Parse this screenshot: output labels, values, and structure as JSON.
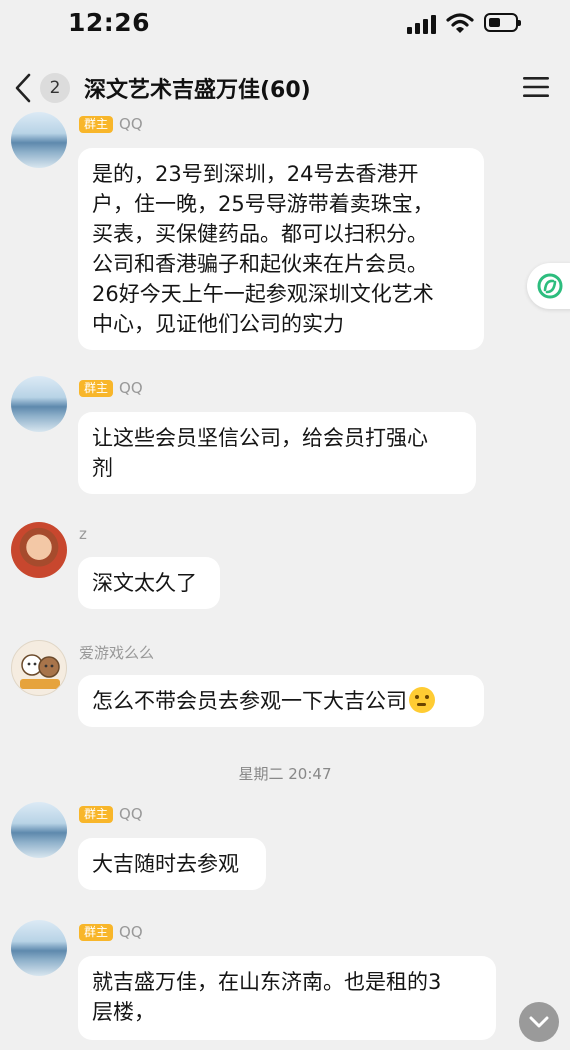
{
  "status_bar": {
    "time": "12:26"
  },
  "header": {
    "unread_count": "2",
    "title": "深文艺术吉盛万佳(60)"
  },
  "messages": [
    {
      "role": "群主",
      "sender": "QQ",
      "lines": [
        "是的，23号到深圳，24号去香港开",
        "户，住一晚，25号导游带着卖珠宝，",
        "买表，买保健药品。都可以扫积分。",
        "公司和香港骗子和起伙来在片会员。",
        "26好今天上午一起参观深圳文化艺术",
        "中心，见证他们公司的实力"
      ]
    },
    {
      "role": "群主",
      "sender": "QQ",
      "lines": [
        "让这些会员坚信公司，给会员打强心",
        "剂"
      ]
    },
    {
      "sender": "z",
      "lines": [
        "深文太久了"
      ]
    },
    {
      "sender": "爱游戏么么",
      "lines": [
        "怎么不带会员去参观一下大吉公司"
      ]
    },
    {
      "role": "群主",
      "sender": "QQ",
      "lines": [
        "大吉随时去参观"
      ]
    },
    {
      "role": "群主",
      "sender": "QQ",
      "lines": [
        "就吉盛万佳，在山东济南。也是租的3",
        "层楼，"
      ]
    }
  ],
  "timestamp": "星期二 20:47",
  "accent_colors": {
    "owner_badge": "#f8b62a",
    "widget_green": "#2dbd7e"
  },
  "icons": [
    "back-chevron-icon",
    "menu-icon",
    "signal-icon",
    "wifi-icon",
    "battery-icon",
    "shortcut-widget-icon",
    "thinking-emoji-icon",
    "scroll-down-icon"
  ]
}
